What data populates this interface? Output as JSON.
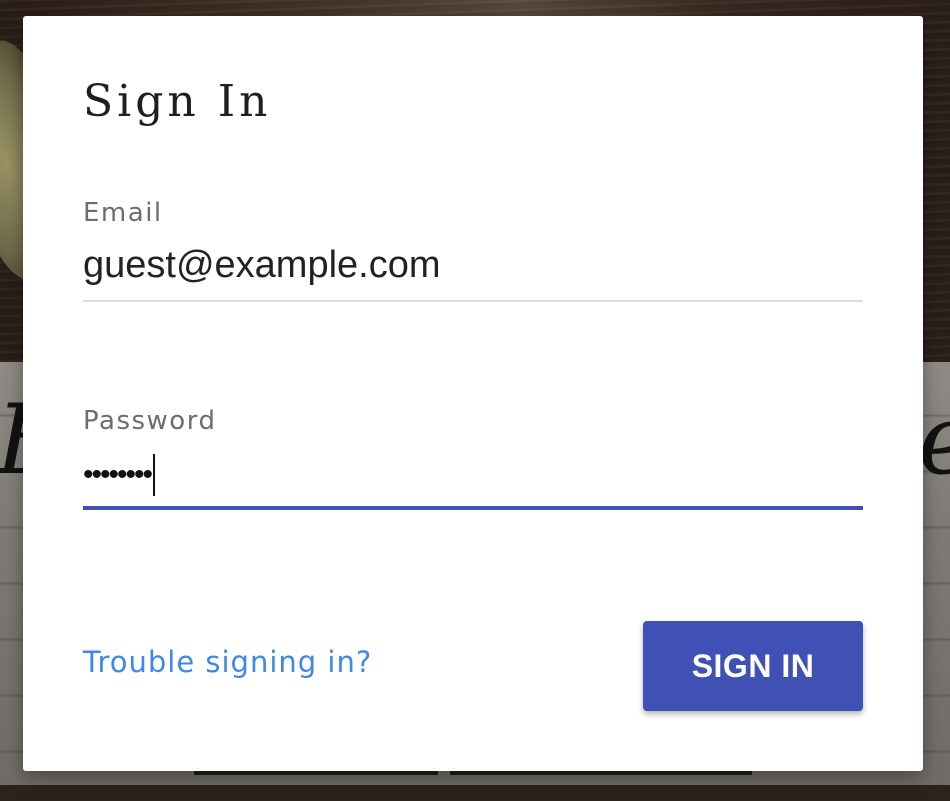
{
  "background": {
    "script_text_left": "B",
    "script_text_right": "e"
  },
  "dialog": {
    "title": "Sign In",
    "email": {
      "label": "Email",
      "value": "guest@example.com"
    },
    "password": {
      "label": "Password",
      "masked_value": "••••••••",
      "focused": true
    },
    "trouble_link": "Trouble signing in?",
    "submit_button": "SIGN IN"
  },
  "colors": {
    "accent": "#3f51b5",
    "link": "#3f88e8",
    "label": "#6d6d6d",
    "underline": "#dcdcdc"
  }
}
